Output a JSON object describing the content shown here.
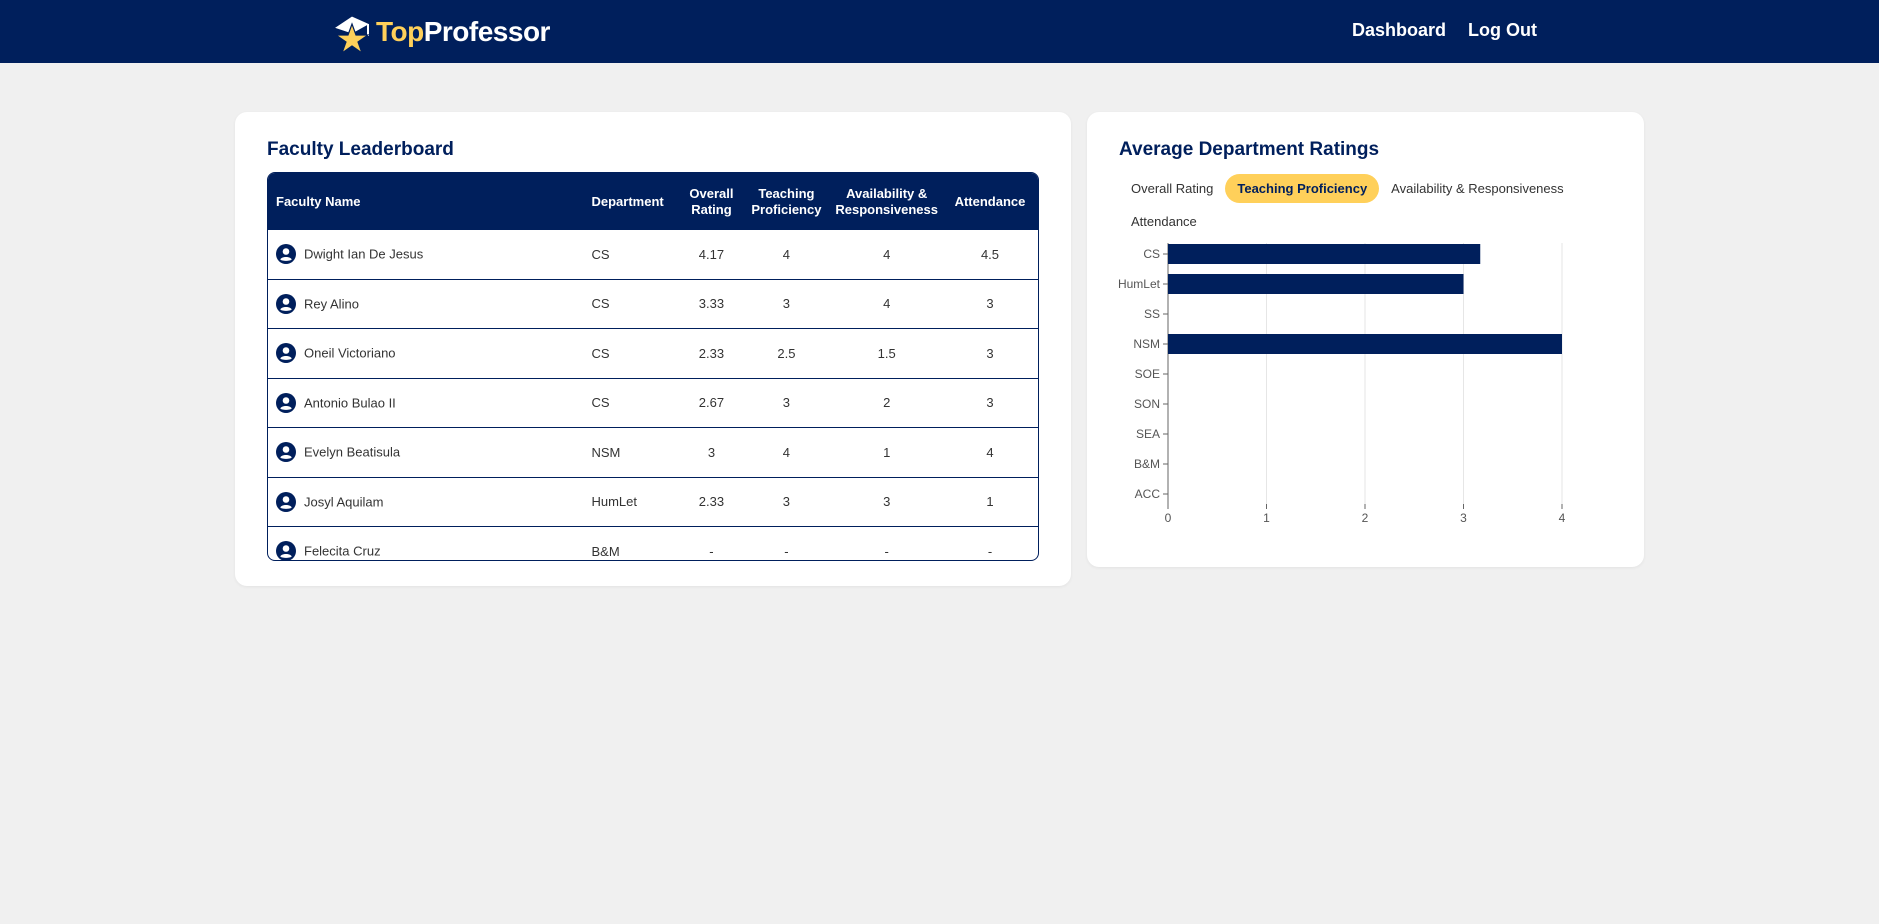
{
  "nav": {
    "logo_part1": "Top",
    "logo_part2": "Professor",
    "links": [
      "Dashboard",
      "Log Out"
    ]
  },
  "leaderboard": {
    "title": "Faculty Leaderboard",
    "columns": {
      "name": "Faculty Name",
      "department": "Department",
      "overall_l1": "Overall",
      "overall_l2": "Rating",
      "teaching_l1": "Teaching",
      "teaching_l2": "Proficiency",
      "avail_l1": "Availability &",
      "avail_l2": "Responsiveness",
      "attendance": "Attendance"
    },
    "rows": [
      {
        "name": "Dwight Ian De Jesus",
        "department": "CS",
        "overall": "4.17",
        "teaching": "4",
        "availability": "4",
        "attendance": "4.5"
      },
      {
        "name": "Rey Alino",
        "department": "CS",
        "overall": "3.33",
        "teaching": "3",
        "availability": "4",
        "attendance": "3"
      },
      {
        "name": "Oneil Victoriano",
        "department": "CS",
        "overall": "2.33",
        "teaching": "2.5",
        "availability": "1.5",
        "attendance": "3"
      },
      {
        "name": "Antonio Bulao II",
        "department": "CS",
        "overall": "2.67",
        "teaching": "3",
        "availability": "2",
        "attendance": "3"
      },
      {
        "name": "Evelyn Beatisula",
        "department": "NSM",
        "overall": "3",
        "teaching": "4",
        "availability": "1",
        "attendance": "4"
      },
      {
        "name": "Josyl Aquilam",
        "department": "HumLet",
        "overall": "2.33",
        "teaching": "3",
        "availability": "3",
        "attendance": "1"
      },
      {
        "name": "Felecita Cruz",
        "department": "B&M",
        "overall": "-",
        "teaching": "-",
        "availability": "-",
        "attendance": "-"
      }
    ]
  },
  "ratings_panel": {
    "title": "Average Department Ratings",
    "tabs": [
      "Overall Rating",
      "Teaching Proficiency",
      "Availability & Responsiveness",
      "Attendance"
    ],
    "active_tab": "Teaching Proficiency"
  },
  "chart_data": {
    "type": "bar",
    "orientation": "horizontal",
    "categories": [
      "CS",
      "HumLet",
      "SS",
      "NSM",
      "SOE",
      "SON",
      "SEA",
      "B&M",
      "ACC"
    ],
    "values": [
      3.17,
      3,
      0,
      4,
      0,
      0,
      0,
      0,
      0
    ],
    "xlim": [
      0,
      4
    ],
    "xticks": [
      "0",
      "1",
      "2",
      "3",
      "4"
    ],
    "grid": true,
    "bar_color": "#001f5c"
  },
  "colors": {
    "navy": "#001f5c",
    "accent": "#ffd05a",
    "background": "#f0f0f0"
  }
}
